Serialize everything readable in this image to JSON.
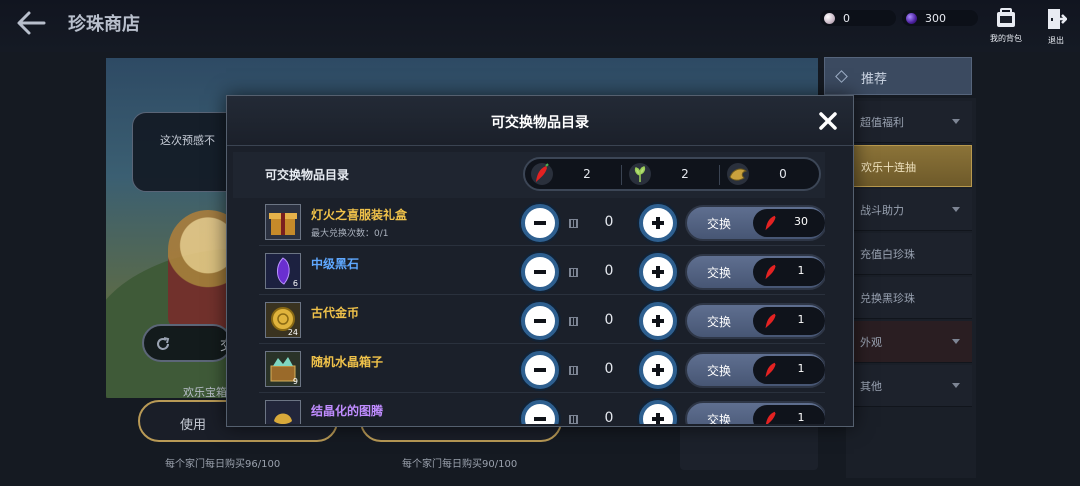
{
  "header": {
    "title": "珍珠商店"
  },
  "currency": {
    "white_pearl": "0",
    "black_pearl": "300"
  },
  "tools": {
    "bag_label": "我的背包",
    "exit_label": "退出"
  },
  "background": {
    "bubble_text": "这次预感不",
    "refresh_char": "交",
    "item_name": "欢乐宝箱",
    "use_label": "使用",
    "limit_left": "每个家门每日购买96/100",
    "limit_right": "每个家门每日购买90/100"
  },
  "side_menu": {
    "header": "推荐",
    "items": [
      {
        "label": "超值福利",
        "has_arrow": true
      },
      {
        "label": "欢乐十连抽",
        "active": true
      },
      {
        "label": "战斗助力",
        "has_arrow": true
      },
      {
        "label": "充值白珍珠"
      },
      {
        "label": "兑换黑珍珠"
      },
      {
        "label": "外观",
        "has_arrow": true
      },
      {
        "label": "其他",
        "has_arrow": true
      }
    ]
  },
  "modal": {
    "title": "可交换物品目录",
    "list_title": "可交换物品目录",
    "tokens": [
      {
        "icon": "red-pepper-icon",
        "count": "2"
      },
      {
        "icon": "green-herb-icon",
        "count": "2"
      },
      {
        "icon": "gold-dragon-icon",
        "count": "0"
      }
    ],
    "exchange_label": "交换",
    "items": [
      {
        "name": "灯火之喜服装礼盒",
        "sub": "最大兑换次数：0/1",
        "qty_badge": "",
        "quantity": "0",
        "cost": "30",
        "color": "#f0c24a",
        "icon": "gift-box-icon"
      },
      {
        "name": "中级黑石",
        "sub": "",
        "qty_badge": "6",
        "quantity": "0",
        "cost": "1",
        "color": "#5fa8ff",
        "icon": "black-stone-icon"
      },
      {
        "name": "古代金币",
        "sub": "",
        "qty_badge": "24",
        "quantity": "0",
        "cost": "1",
        "color": "#f0c24a",
        "icon": "gold-coin-icon"
      },
      {
        "name": "随机水晶箱子",
        "sub": "",
        "qty_badge": "9",
        "quantity": "0",
        "cost": "1",
        "color": "#f0c24a",
        "icon": "crystal-chest-icon"
      },
      {
        "name": "结晶化的图腾",
        "sub": "",
        "qty_badge": "",
        "quantity": "0",
        "cost": "1",
        "color": "#c08cff",
        "icon": "crystal-totem-icon"
      }
    ]
  },
  "colors": {
    "accent_gold": "#f0c24a",
    "accent_blue": "#5fa8ff",
    "accent_purple": "#c08cff",
    "stepper_ring": "#2e5f8f"
  }
}
